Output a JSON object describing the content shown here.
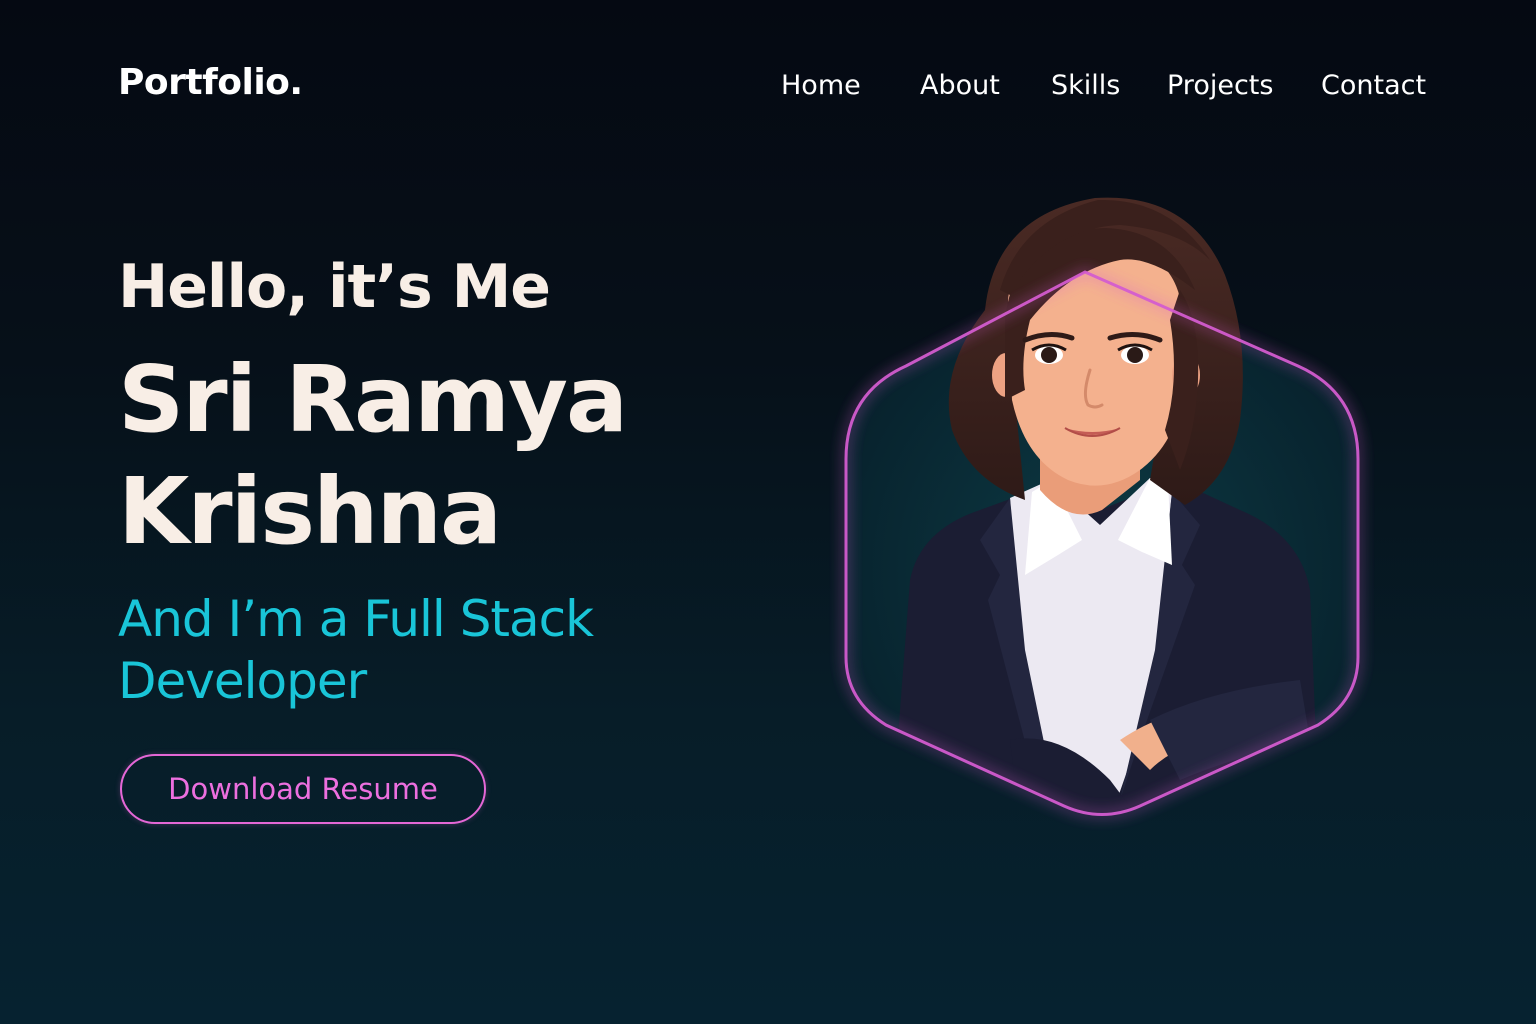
{
  "brand": {
    "logo_text": "Portfolio."
  },
  "nav": {
    "items": [
      {
        "label": "Home"
      },
      {
        "label": "About"
      },
      {
        "label": "Skills"
      },
      {
        "label": "Projects"
      },
      {
        "label": "Contact"
      }
    ]
  },
  "hero": {
    "greeting": "Hello, it’s Me",
    "name_line1": "Sri Ramya",
    "name_line2": "Krishna",
    "role_line1": "And I’m a Full Stack",
    "role_line2": "Developer",
    "download_label": "Download Resume"
  },
  "colors": {
    "background_top": "#050912",
    "background_bottom": "#062230",
    "heading_text": "#f8eee6",
    "accent_cyan": "#19c5d8",
    "accent_pink": "#e467d6"
  },
  "icons": {
    "portrait": "avatar-illustration"
  }
}
